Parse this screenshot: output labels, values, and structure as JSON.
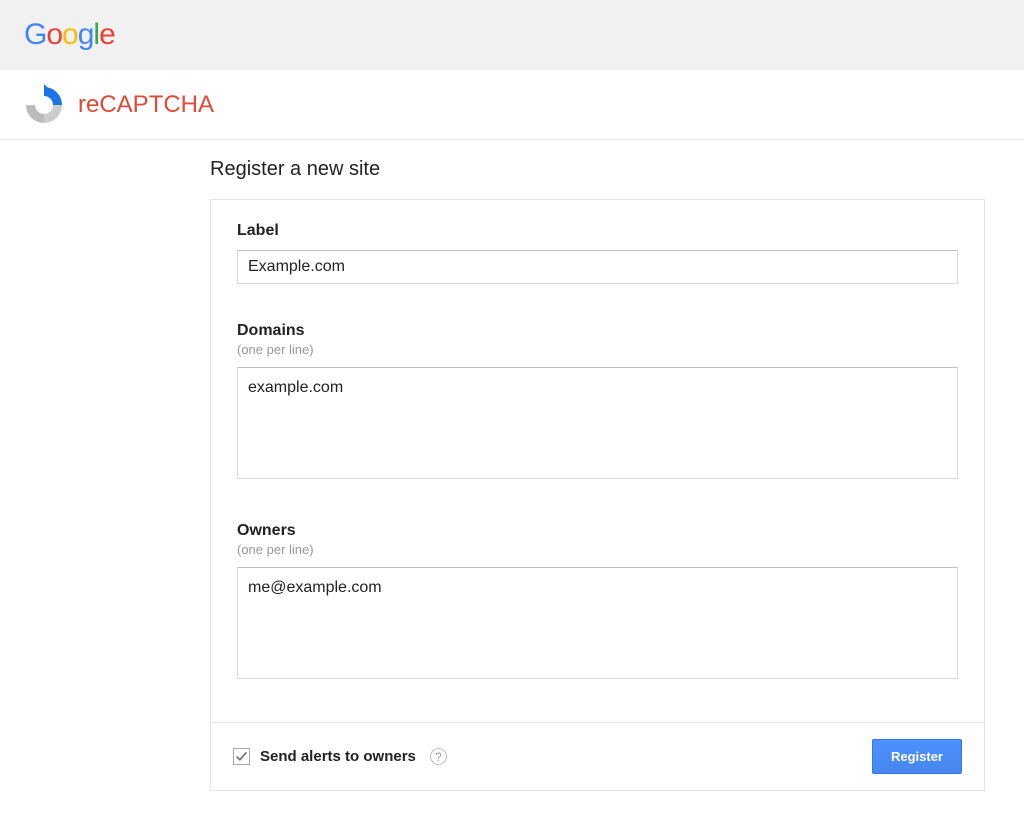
{
  "brand": {
    "google": [
      "G",
      "o",
      "o",
      "g",
      "l",
      "e"
    ],
    "recaptcha": "reCAPTCHA"
  },
  "page": {
    "heading": "Register a new site"
  },
  "form": {
    "label": {
      "title": "Label",
      "value": "Example.com"
    },
    "domains": {
      "title": "Domains",
      "hint": "(one per line)",
      "value": "example.com"
    },
    "owners": {
      "title": "Owners",
      "hint": "(one per line)",
      "value": "me@example.com"
    },
    "footer": {
      "alerts_label": "Send alerts to owners",
      "alerts_checked": true,
      "help": "?",
      "register": "Register"
    }
  }
}
